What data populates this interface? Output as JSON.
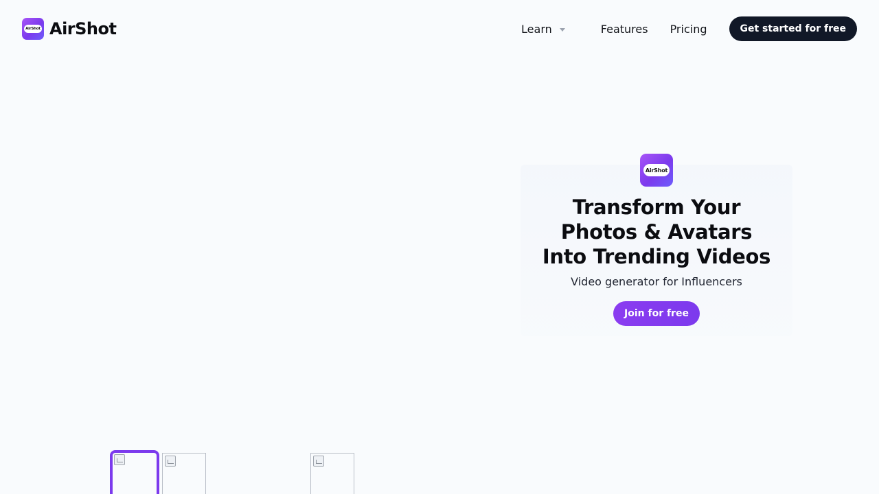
{
  "header": {
    "brand": {
      "name": "AirShot",
      "logo_text": "AirShot"
    },
    "nav": {
      "learn": "Learn",
      "features": "Features",
      "pricing": "Pricing"
    },
    "cta": "Get started for free"
  },
  "hero": {
    "logo_text": "AirShot",
    "title_lines": [
      "Transform Your",
      "Photos & Avatars",
      "Into Trending Videos"
    ],
    "subtitle": "Video generator for Influencers",
    "cta": "Join for free"
  },
  "thumbnails": {
    "selected_index": 0
  },
  "colors": {
    "background": "#f9fbfd",
    "brand_purple": "#7c3aed",
    "dark_button": "#111827"
  },
  "icons": {
    "learn_caret": "chevron-down-icon",
    "thumbnail_placeholder": "broken-image-icon"
  }
}
